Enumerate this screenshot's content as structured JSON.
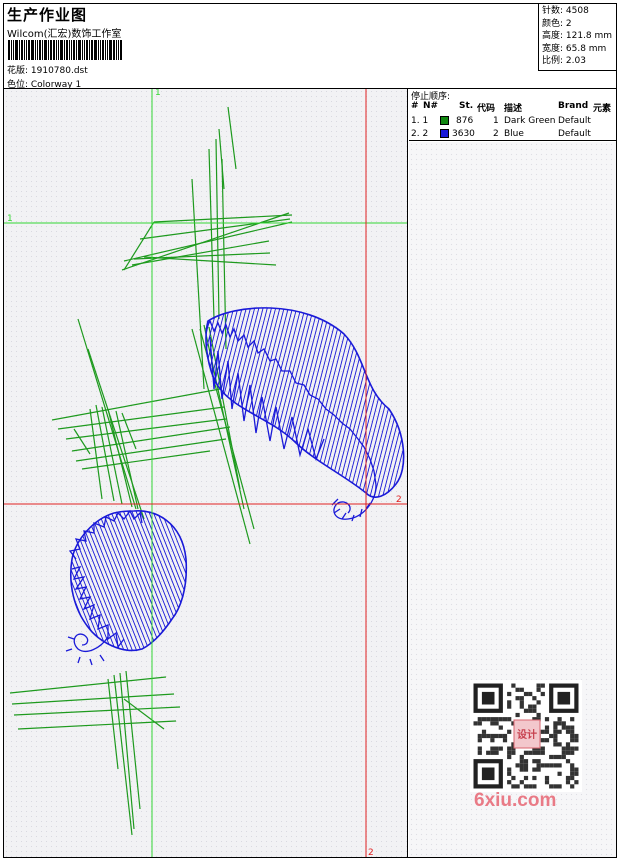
{
  "header": {
    "title": "生产作业图",
    "studio": "Wilcom(汇宏)数饰工作室",
    "design": "花版: 1910780.dst",
    "colorway": "色位: Colorway 1"
  },
  "stats": [
    "针数: 4508",
    "颜色: 2",
    "高度: 121.8 mm",
    "宽度: 65.8 mm",
    "比例: 2.03"
  ],
  "stop_sequence": {
    "title": "停止顺序:",
    "columns": [
      "#",
      "N#",
      "St.",
      "代码",
      "描述",
      "Brand",
      "元素"
    ],
    "rows": [
      {
        "index": "1. 1",
        "color": "#118811",
        "stitches": "876",
        "code": "1",
        "desc": "Dark Green",
        "brand": "Default"
      },
      {
        "index": "2. 2",
        "color": "#1a1ad8",
        "stitches": "3630",
        "code": "2",
        "desc": "Blue",
        "brand": "Default"
      }
    ]
  },
  "guides": {
    "green_h_label": "1",
    "green_v_label": "1",
    "red_h_label": "2",
    "red_v_label": "2"
  },
  "colors": {
    "green_thread": "#1e9a1e",
    "blue_thread": "#1a1ad8",
    "green_guide": "#33d633",
    "red_guide": "#e02020"
  },
  "watermark": "6xiu.com",
  "qr_badge": "设计"
}
